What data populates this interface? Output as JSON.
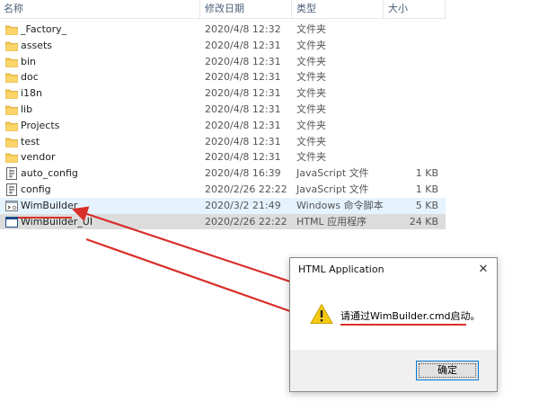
{
  "columns": {
    "name": "名称",
    "date": "修改日期",
    "type": "类型",
    "size": "大小"
  },
  "files": [
    {
      "name": "_Factory_",
      "date": "2020/4/8 12:32",
      "type": "文件夹",
      "size": "",
      "icon": "folder-icon"
    },
    {
      "name": "assets",
      "date": "2020/4/8 12:31",
      "type": "文件夹",
      "size": "",
      "icon": "folder-icon"
    },
    {
      "name": "bin",
      "date": "2020/4/8 12:31",
      "type": "文件夹",
      "size": "",
      "icon": "folder-icon"
    },
    {
      "name": "doc",
      "date": "2020/4/8 12:31",
      "type": "文件夹",
      "size": "",
      "icon": "folder-icon"
    },
    {
      "name": "i18n",
      "date": "2020/4/8 12:31",
      "type": "文件夹",
      "size": "",
      "icon": "folder-icon"
    },
    {
      "name": "lib",
      "date": "2020/4/8 12:31",
      "type": "文件夹",
      "size": "",
      "icon": "folder-icon"
    },
    {
      "name": "Projects",
      "date": "2020/4/8 12:31",
      "type": "文件夹",
      "size": "",
      "icon": "folder-icon"
    },
    {
      "name": "test",
      "date": "2020/4/8 12:31",
      "type": "文件夹",
      "size": "",
      "icon": "folder-icon"
    },
    {
      "name": "vendor",
      "date": "2020/4/8 12:31",
      "type": "文件夹",
      "size": "",
      "icon": "folder-icon"
    },
    {
      "name": "auto_config",
      "date": "2020/4/8 16:39",
      "type": "JavaScript 文件",
      "size": "1 KB",
      "icon": "script-file-icon"
    },
    {
      "name": "config",
      "date": "2020/2/26 22:22",
      "type": "JavaScript 文件",
      "size": "1 KB",
      "icon": "script-file-icon"
    },
    {
      "name": "WimBuilder",
      "date": "2020/3/2 21:49",
      "type": "Windows 命令脚本",
      "size": "5 KB",
      "icon": "cmd-file-icon"
    },
    {
      "name": "WimBuilder_UI",
      "date": "2020/2/26 22:22",
      "type": "HTML 应用程序",
      "size": "24 KB",
      "icon": "hta-file-icon"
    }
  ],
  "dialog": {
    "title": "HTML Application",
    "close_glyph": "✕",
    "message": "请通过WimBuilder.cmd启动。",
    "ok_label": "确定"
  },
  "colors": {
    "annotation_red": "#d8302a",
    "folder": "#f5c64f",
    "focus_blue": "#0078d7"
  }
}
